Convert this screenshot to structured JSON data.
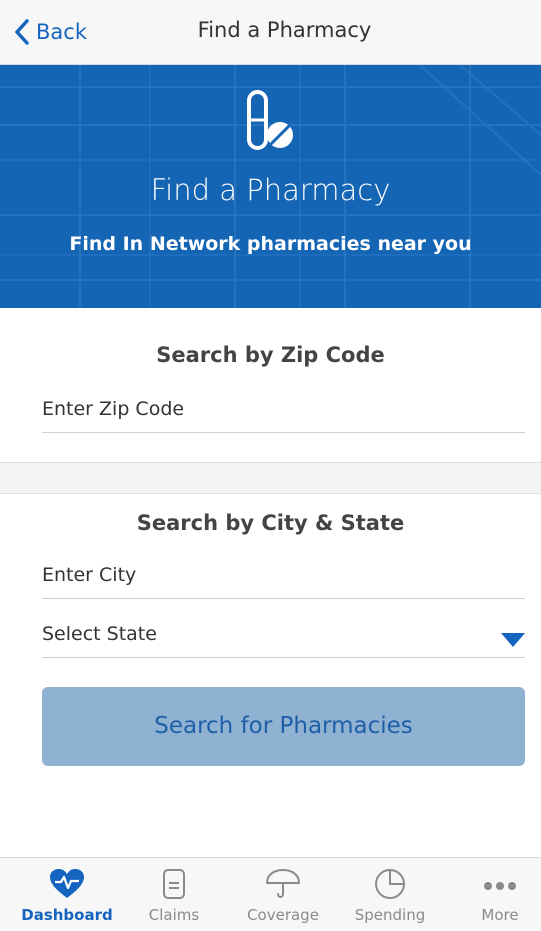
{
  "navbar": {
    "back_label": "Back",
    "title": "Find a Pharmacy"
  },
  "hero": {
    "icon": "pill-icon",
    "title": "Find a Pharmacy",
    "subtitle": "Find In Network pharmacies near you"
  },
  "zip_section": {
    "title": "Search by Zip Code",
    "zip_placeholder": "Enter Zip Code"
  },
  "city_state_section": {
    "title": "Search by City & State",
    "city_placeholder": "Enter City",
    "state_value": "Select State"
  },
  "search_button_label": "Search for Pharmacies",
  "tabs": [
    {
      "label": "Dashboard",
      "icon": "heart-pulse-icon",
      "active": true
    },
    {
      "label": "Claims",
      "icon": "document-icon",
      "active": false
    },
    {
      "label": "Coverage",
      "icon": "umbrella-icon",
      "active": false
    },
    {
      "label": "Spending",
      "icon": "pie-chart-icon",
      "active": false
    },
    {
      "label": "More",
      "icon": "more-dots-icon",
      "active": false
    }
  ],
  "colors": {
    "accent": "#1565c0",
    "hero_bg": "#1565b5",
    "button_bg": "#8fb1d2",
    "tab_inactive": "#8a8a8a"
  }
}
